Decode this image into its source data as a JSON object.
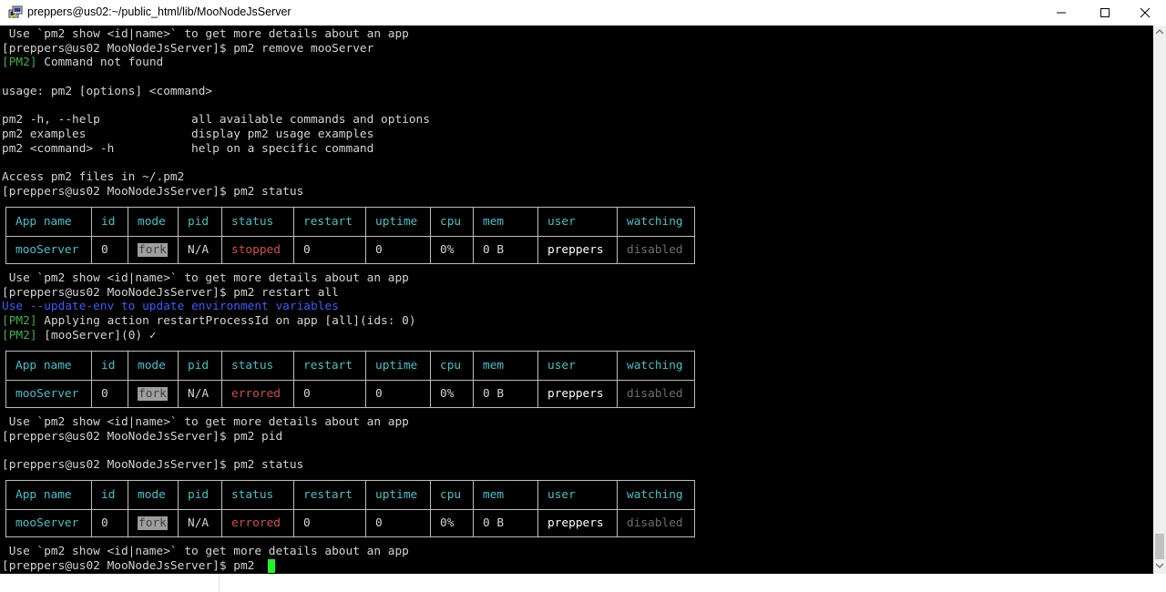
{
  "window": {
    "title": "preppers@us02:~/public_html/lib/MooNodeJsServer",
    "icon": "putty-icon"
  },
  "terminal": {
    "lines": [
      " Use `pm2 show <id|name>` to get more details about an app",
      "[preppers@us02 MooNodeJsServer]$ pm2 remove mooServer",
      "Command not found",
      "usage: pm2 [options] <command>",
      "pm2 -h, --help             all available commands and options",
      "pm2 examples               display pm2 usage examples",
      "pm2 <command> -h           help on a specific command",
      "Access pm2 files in ~/.pm2",
      "[preppers@us02 MooNodeJsServer]$ pm2 status",
      " Use `pm2 show <id|name>` to get more details about an app",
      "[preppers@us02 MooNodeJsServer]$ pm2 restart all",
      "Use --update-env to update environment variables",
      "Applying action restartProcessId on app [all](ids: 0)",
      "[mooServer](0) ✓",
      " Use `pm2 show <id|name>` to get more details about an app",
      "[preppers@us02 MooNodeJsServer]$ pm2 pid",
      "[preppers@us02 MooNodeJsServer]$ pm2 status",
      " Use `pm2 show <id|name>` to get more details about an app",
      "[preppers@us02 MooNodeJsServer]$ pm2 "
    ],
    "pm2_tag": "[PM2]",
    "table_headers": [
      "App name",
      "id",
      "mode",
      "pid",
      "status",
      "restart",
      "uptime",
      "cpu",
      "mem",
      "user",
      "watching"
    ],
    "tables": [
      {
        "app_name": "mooServer",
        "id": "0",
        "mode": "fork",
        "pid": "N/A",
        "status": "stopped",
        "restart": "0",
        "uptime": "0",
        "cpu": "0%",
        "mem": "0 B",
        "user": "preppers",
        "watching": "disabled"
      },
      {
        "app_name": "mooServer",
        "id": "0",
        "mode": "fork",
        "pid": "N/A",
        "status": "errored",
        "restart": "0",
        "uptime": "0",
        "cpu": "0%",
        "mem": "0 B",
        "user": "preppers",
        "watching": "disabled"
      },
      {
        "app_name": "mooServer",
        "id": "0",
        "mode": "fork",
        "pid": "N/A",
        "status": "errored",
        "restart": "0",
        "uptime": "0",
        "cpu": "0%",
        "mem": "0 B",
        "user": "preppers",
        "watching": "disabled"
      }
    ]
  },
  "colors": {
    "background": "#000000",
    "text": "#d3d3d3",
    "pm2_tag": "#39b54a",
    "header": "#3fc2c9",
    "error": "#d64b4b",
    "info": "#3b5bff",
    "cursor": "#21f521"
  }
}
